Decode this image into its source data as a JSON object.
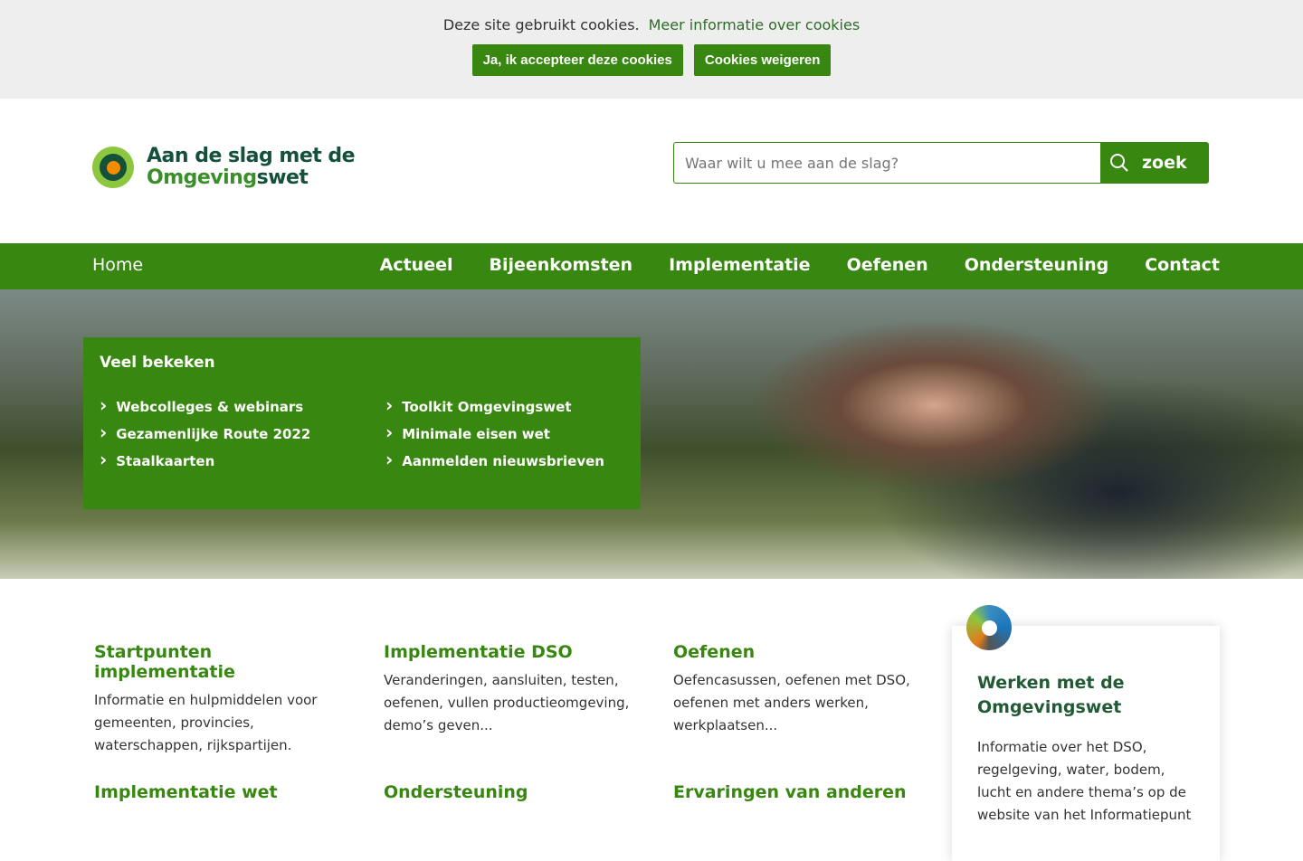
{
  "cookie": {
    "text": "Deze site gebruikt cookies.",
    "link": "Meer informatie over cookies",
    "accept": "Ja, ik accepteer deze cookies",
    "refuse": "Cookies weigeren"
  },
  "logo": {
    "line1": "Aan de slag met de",
    "line2a": "Omgeving",
    "line2b": "swet"
  },
  "search": {
    "placeholder": "Waar wilt u mee aan de slag?",
    "button": "zoek"
  },
  "nav": {
    "home": "Home",
    "items": [
      "Actueel",
      "Bijeenkomsten",
      "Implementatie",
      "Oefenen",
      "Ondersteuning",
      "Contact"
    ]
  },
  "panel": {
    "title": "Veel bekeken",
    "links": [
      "Webcolleges & webinars",
      "Toolkit Omgevingswet",
      "Gezamenlijke Route 2022",
      "Minimale eisen wet",
      "Staalkaarten",
      "Aanmelden nieuwsbrieven"
    ]
  },
  "tiles": [
    {
      "title": "Startpunten implementatie",
      "text": "Informatie en hulpmiddelen voor gemeenten, provincies, waterschappen, rijkspartijen."
    },
    {
      "title": "Implementatie DSO",
      "text": "Veranderingen, aansluiten, testen, oefenen, vullen productieomgeving, demo’s geven..."
    },
    {
      "title": "Oefenen",
      "text": "Oefencasussen, oefenen met DSO, oefenen met anders werken, werkplaatsen..."
    },
    {
      "title": "Implementatie wet"
    },
    {
      "title": "Ondersteuning"
    },
    {
      "title": "Ervaringen van anderen"
    }
  ],
  "card": {
    "title": "Werken met de Omgevingswet",
    "text": "Informatie over het DSO, regelgeving, water, bodem, lucht en andere thema’s op de website van het Informatiepunt"
  }
}
